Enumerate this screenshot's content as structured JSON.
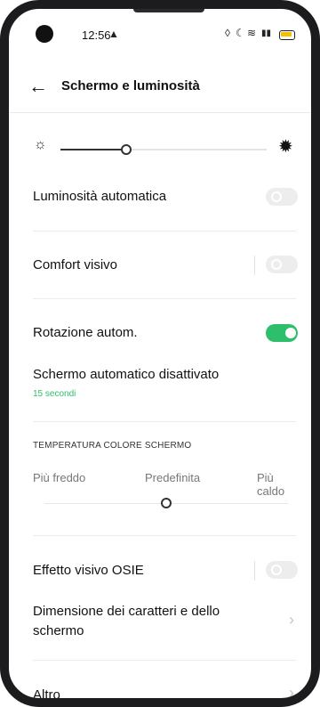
{
  "status_bar": {
    "time": "12:56",
    "icons": [
      "alert-triangle-icon",
      "drop-icon",
      "moon-icon",
      "wifi-icon",
      "signal-icon",
      "battery-icon"
    ]
  },
  "header": {
    "back_icon": "arrow-left-icon",
    "title": "Schermo e luminosità"
  },
  "brightness": {
    "level": 0.32,
    "low_icon": "sun-small-icon",
    "high_icon": "sun-large-icon"
  },
  "rows": {
    "auto_brightness": {
      "label": "Luminosità automatica",
      "toggle": "off"
    },
    "eye_comfort": {
      "label": "Comfort visivo",
      "toggle": "off"
    },
    "auto_rotate": {
      "label": "Rotazione autom.",
      "toggle": "on"
    },
    "screen_timeout": {
      "label": "Schermo automatico disattivato",
      "value": "15 secondi"
    }
  },
  "color_temperature": {
    "caption": "TEMPERATURA COLORE SCHERMO",
    "labels": [
      "Più freddo",
      "Predefinita",
      "Più caldo"
    ],
    "position": 0.5
  },
  "more_rows": {
    "osie": {
      "label": "Effetto visivo OSIE",
      "toggle": "off"
    },
    "font_display_size": {
      "label_line1": "Dimensione dei caratteri e dello",
      "label_line2": "schermo"
    },
    "other": {
      "label": "Altro"
    }
  },
  "colors": {
    "accent": "#2dbf6b",
    "text": "#111111",
    "muted": "#777777"
  }
}
